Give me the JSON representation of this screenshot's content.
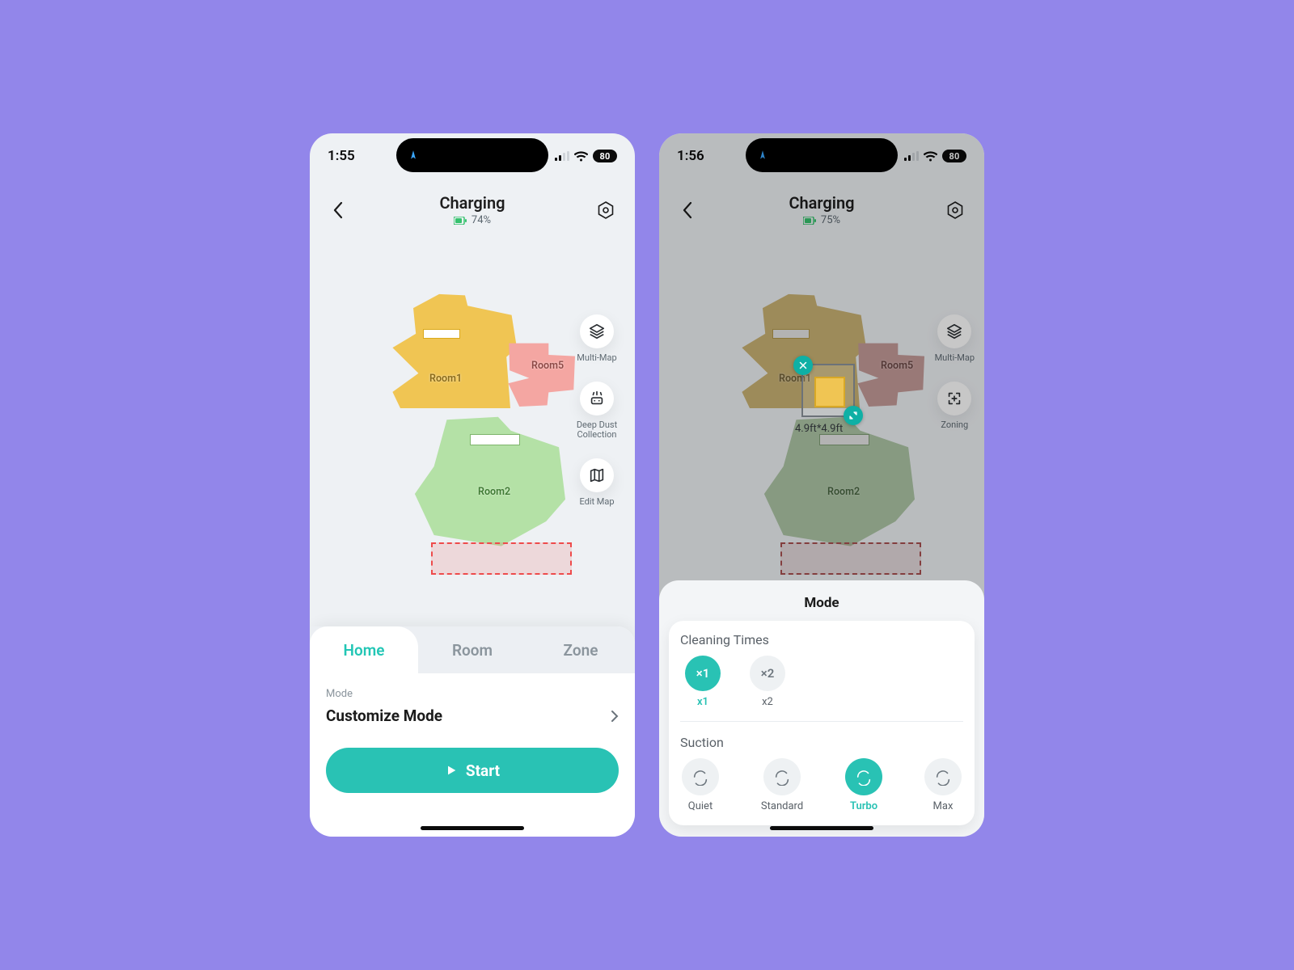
{
  "left": {
    "status": {
      "time": "1:55",
      "battery": "80"
    },
    "header": {
      "title": "Charging",
      "battery": "74%"
    },
    "rooms": {
      "r1": "Room1",
      "r2": "Room2",
      "r5": "Room5"
    },
    "tools": {
      "multiMap": "Multi-Map",
      "deepDust": "Deep Dust Collection",
      "editMap": "Edit Map"
    },
    "tabs": {
      "home": "Home",
      "room": "Room",
      "zone": "Zone"
    },
    "mode": {
      "label": "Mode",
      "value": "Customize Mode"
    },
    "start": "Start"
  },
  "right": {
    "status": {
      "time": "1:56",
      "battery": "80"
    },
    "header": {
      "title": "Charging",
      "battery": "75%"
    },
    "tools": {
      "multiMap": "Multi-Map",
      "zoning": "Zoning"
    },
    "zone": {
      "dimensions": "4.9ft*4.9ft"
    },
    "panel": {
      "title": "Mode",
      "cleaning": {
        "label": "Cleaning Times",
        "options": [
          {
            "key": "x1",
            "label": "×1",
            "sublabel": "x1",
            "active": true
          },
          {
            "key": "x2",
            "label": "×2",
            "sublabel": "x2",
            "active": false
          }
        ]
      },
      "suction": {
        "label": "Suction",
        "options": [
          {
            "key": "quiet",
            "label": "Quiet",
            "active": false
          },
          {
            "key": "standard",
            "label": "Standard",
            "active": false
          },
          {
            "key": "turbo",
            "label": "Turbo",
            "active": true
          },
          {
            "key": "max",
            "label": "Max",
            "active": false
          }
        ]
      }
    }
  }
}
